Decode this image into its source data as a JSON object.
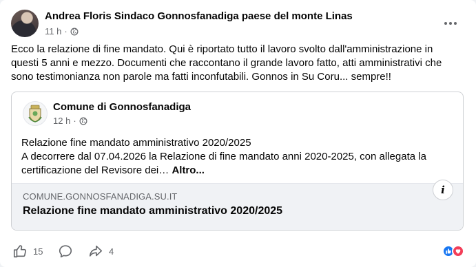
{
  "post": {
    "author": "Andrea Floris Sindaco Gonnosfanadiga paese del monte Linas",
    "time": "11 h",
    "separator": "·",
    "text": "Ecco la relazione di fine mandato. Qui è riportato tutto il lavoro svolto dall'amministrazione in questi 5 anni e mezzo. Documenti che raccontano il grande lavoro fatto, atti amministrativi che sono  testimonianza non parole ma fatti inconfutabili.  Gonnos in Su Coru... sempre!!"
  },
  "shared_post": {
    "page_name": "Comune di Gonnosfanadiga",
    "time": "12 h",
    "separator": "·",
    "line1": "Relazione fine mandato amministrativo 2020/2025",
    "line2": " A decorrere dal 07.04.2026 la Relazione di fine mandato anni 2020-2025, con allegata la certificazione del Revisore dei… ",
    "see_more": "Altro...",
    "link": {
      "domain": "COMUNE.GONNOSFANADIGA.SU.IT",
      "title": "Relazione fine mandato amministrativo 2020/2025",
      "info_icon_text": "i"
    }
  },
  "footer": {
    "likes": "15",
    "shares": "4"
  },
  "icons": {
    "globe": "globe-icon",
    "like": "thumbs-up-icon",
    "comment": "comment-icon",
    "share": "share-icon",
    "more": "more-options-icon"
  },
  "colors": {
    "like_blue": "#1877f2",
    "love_red": "#f33e58",
    "secondary_text": "#65676b"
  }
}
